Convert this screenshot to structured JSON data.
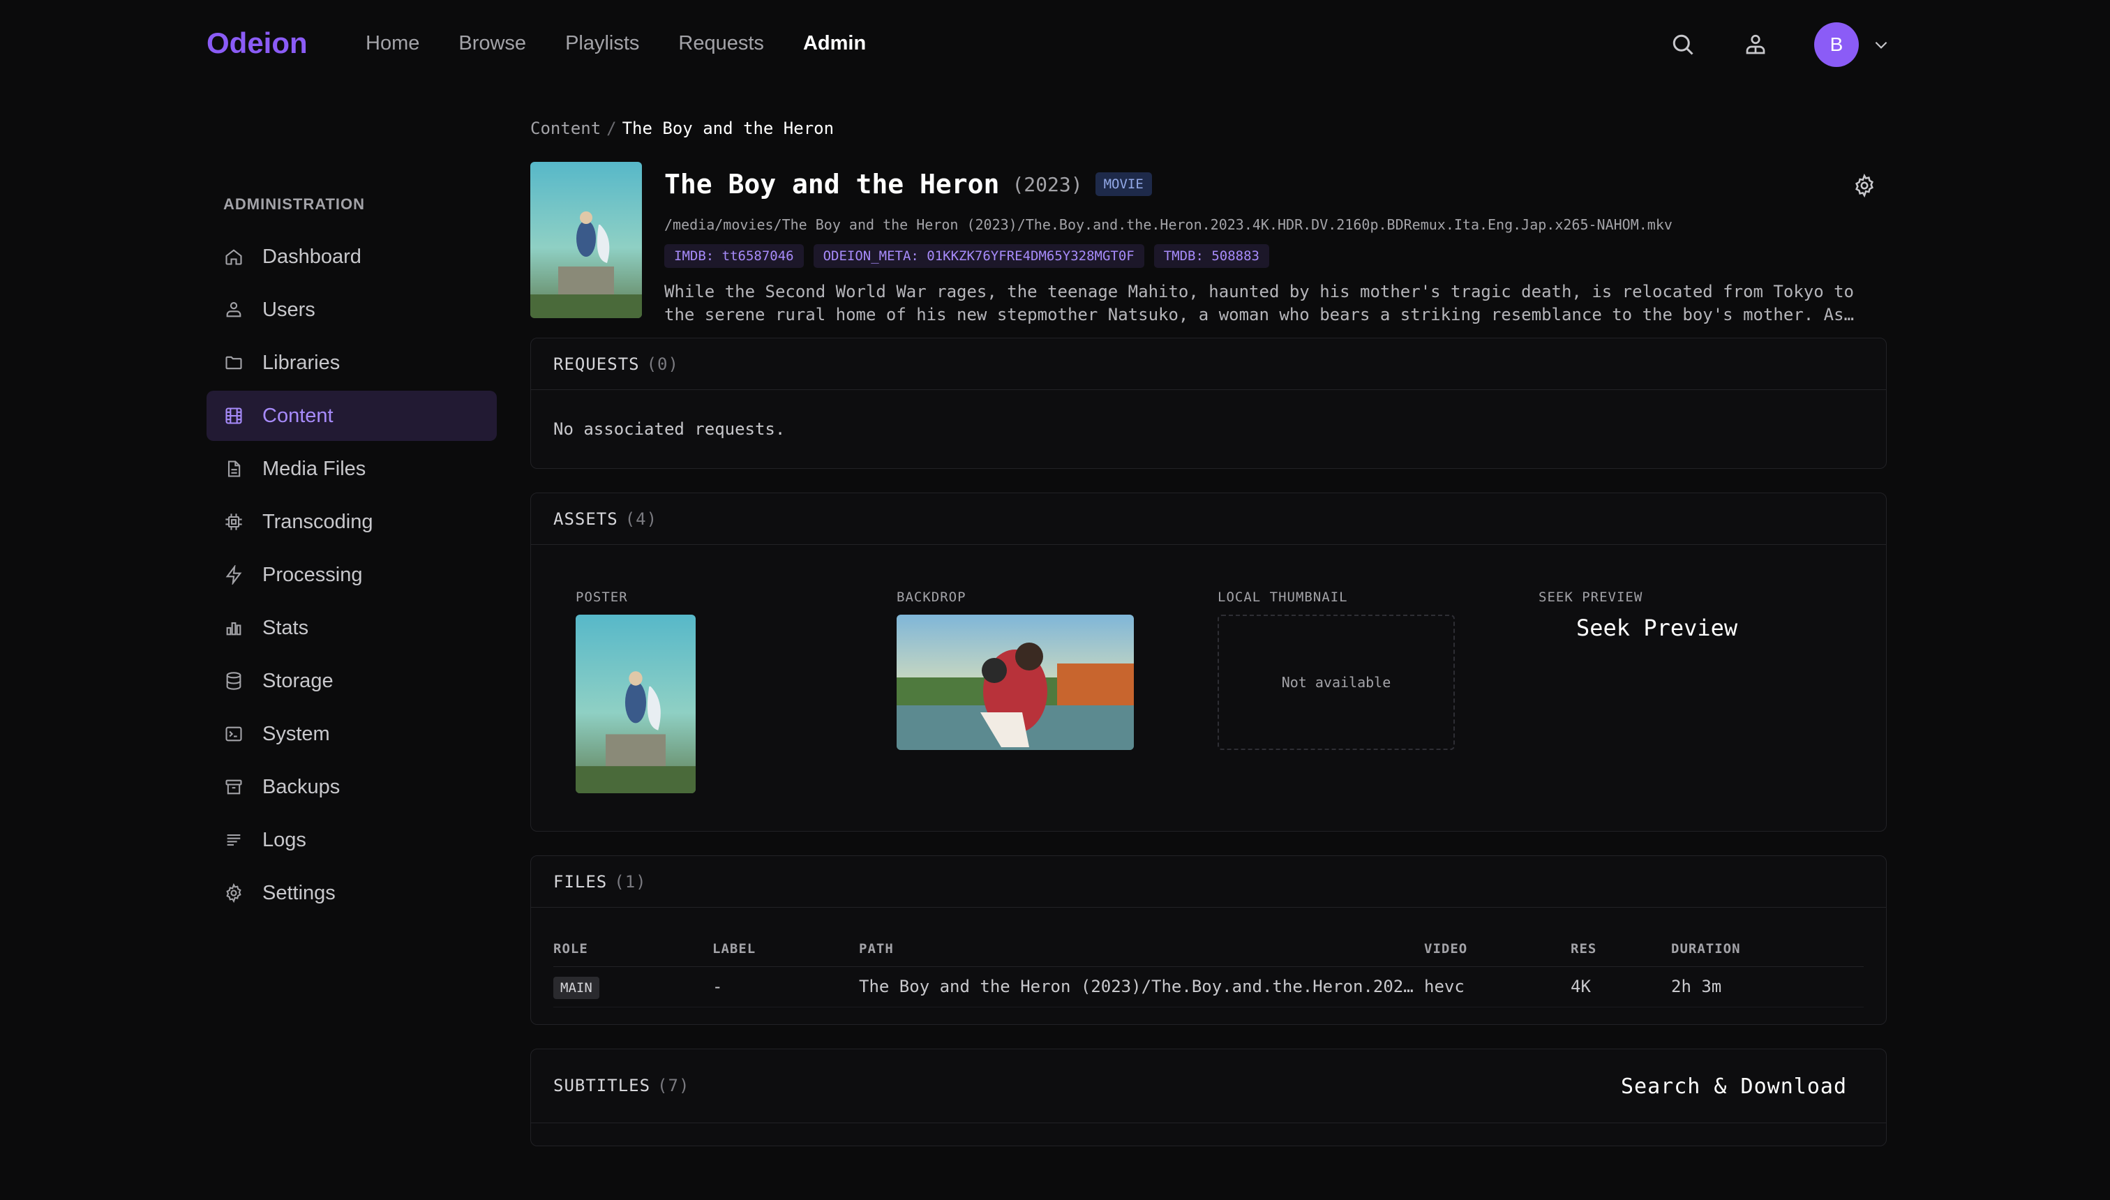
{
  "brand": "Odeion",
  "nav": {
    "links": [
      "Home",
      "Browse",
      "Playlists",
      "Requests",
      "Admin"
    ],
    "active": "Admin",
    "avatar_initial": "B"
  },
  "sidebar": {
    "heading": "ADMINISTRATION",
    "items": [
      {
        "label": "Dashboard",
        "icon": "home-icon"
      },
      {
        "label": "Users",
        "icon": "users-icon"
      },
      {
        "label": "Libraries",
        "icon": "folder-icon"
      },
      {
        "label": "Content",
        "icon": "film-icon",
        "active": true
      },
      {
        "label": "Media Files",
        "icon": "file-icon"
      },
      {
        "label": "Transcoding",
        "icon": "cpu-icon"
      },
      {
        "label": "Processing",
        "icon": "bolt-icon"
      },
      {
        "label": "Stats",
        "icon": "bar-chart-icon"
      },
      {
        "label": "Storage",
        "icon": "database-icon"
      },
      {
        "label": "System",
        "icon": "terminal-icon"
      },
      {
        "label": "Backups",
        "icon": "archive-icon"
      },
      {
        "label": "Logs",
        "icon": "list-icon"
      },
      {
        "label": "Settings",
        "icon": "gear-icon"
      }
    ]
  },
  "breadcrumb": {
    "parent": "Content",
    "sep": "/",
    "current": "The Boy and the Heron"
  },
  "content": {
    "title": "The Boy and the Heron",
    "year": "(2023)",
    "type": "MOVIE",
    "path": "/media/movies/The Boy and the Heron (2023)/The.Boy.and.the.Heron.2023.4K.HDR.DV.2160p.BDRemux.Ita.Eng.Jap.x265-NAHOM.mkv",
    "ids": [
      "IMDB: tt6587046",
      "ODEION_META: 01KKZK76YFRE4DM65Y328MGT0F",
      "TMDB: 508883"
    ],
    "overview": "While the Second World War rages, the teenage Mahito, haunted by his mother's tragic death, is relocated from Tokyo to the serene rural home of his new stepmother Natsuko, a woman who bears a striking resemblance to the boy's mother. As he…"
  },
  "requests": {
    "title": "REQUESTS",
    "count": "(0)",
    "empty": "No associated requests."
  },
  "assets": {
    "title": "ASSETS",
    "count": "(4)",
    "poster_label": "POSTER",
    "backdrop_label": "BACKDROP",
    "thumb_label": "LOCAL THUMBNAIL",
    "thumb_empty": "Not available",
    "seek_label": "SEEK PREVIEW",
    "seek_button": "Seek Preview"
  },
  "files": {
    "title": "FILES",
    "count": "(1)",
    "columns": [
      "ROLE",
      "LABEL",
      "PATH",
      "VIDEO",
      "RES",
      "DURATION"
    ],
    "rows": [
      {
        "role": "MAIN",
        "label": "-",
        "path": "The Boy and the Heron (2023)/The.Boy.and.the.Heron.202…",
        "video": "hevc",
        "res": "4K",
        "duration": "2h 3m"
      }
    ]
  },
  "subtitles": {
    "title": "SUBTITLES",
    "count": "(7)",
    "action": "Search & Download"
  },
  "colors": {
    "accent": "#8b5cf6",
    "background": "#0b0b0c",
    "active_bg": "#221a33"
  }
}
